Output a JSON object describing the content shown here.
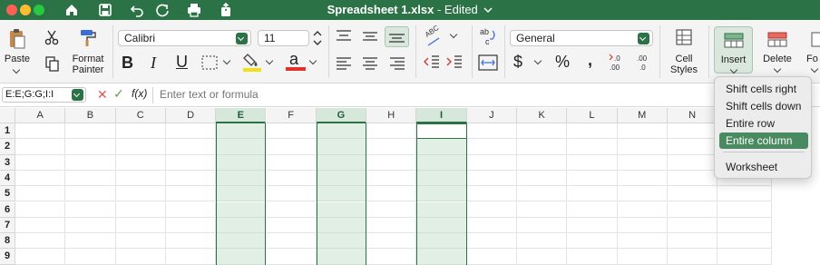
{
  "window": {
    "title": "Spreadsheet 1.xlsx",
    "status": " - Edited",
    "status_chevron": "chevron-down-icon"
  },
  "ribbon": {
    "paste_label": "Paste",
    "format_painter_label_1": "Format",
    "format_painter_label_2": "Painter",
    "font_name": "Calibri",
    "font_size": "11",
    "number_format": "General",
    "currency_symbol": "$",
    "percent_symbol": "%",
    "comma_symbol": ",",
    "cell_styles_label_1": "Cell",
    "cell_styles_label_2": "Styles",
    "insert_label": "Insert",
    "delete_label": "Delete",
    "format_label_partial": "Fo",
    "bold": "B",
    "italic": "I",
    "underline": "U",
    "font_color_letter": "a",
    "wrap_text_label": "ab\nc",
    "angle_label": "ABC",
    "inc_decimal": ".0\n.00",
    "dec_decimal": ".00\n.0",
    "accent_color": "#2b7247",
    "highlight_color": "#f4e017",
    "font_color": "#e0312b"
  },
  "formula_bar": {
    "name_box": "E:E;G:G;I:I",
    "fx_label": "f(x)",
    "placeholder": "Enter text or formula"
  },
  "grid": {
    "columns": [
      "A",
      "B",
      "C",
      "D",
      "E",
      "F",
      "G",
      "H",
      "I",
      "J",
      "K",
      "L",
      "M",
      "N"
    ],
    "selected_columns": [
      "E",
      "G",
      "I"
    ],
    "rows": [
      "1",
      "2",
      "3",
      "4",
      "5",
      "6",
      "7",
      "8",
      "9"
    ]
  },
  "insert_menu": {
    "items": [
      "Shift cells right",
      "Shift cells down",
      "Entire row",
      "Entire column",
      "Worksheet"
    ],
    "highlighted": "Entire column"
  }
}
